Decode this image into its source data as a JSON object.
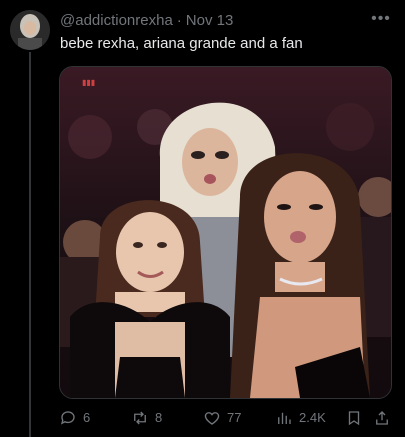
{
  "tweet": {
    "handle": "@addictionrexha",
    "separator": "·",
    "date": "Nov 13",
    "text": "bebe rexha, ariana grande and a fan",
    "more_icon": "more-dots-icon"
  },
  "actions": {
    "replies": "6",
    "retweets": "8",
    "likes": "77",
    "views": "2.4K"
  },
  "colors": {
    "background": "#000000",
    "text": "#e7e9ea",
    "muted": "#71767b",
    "divider": "#333639"
  }
}
